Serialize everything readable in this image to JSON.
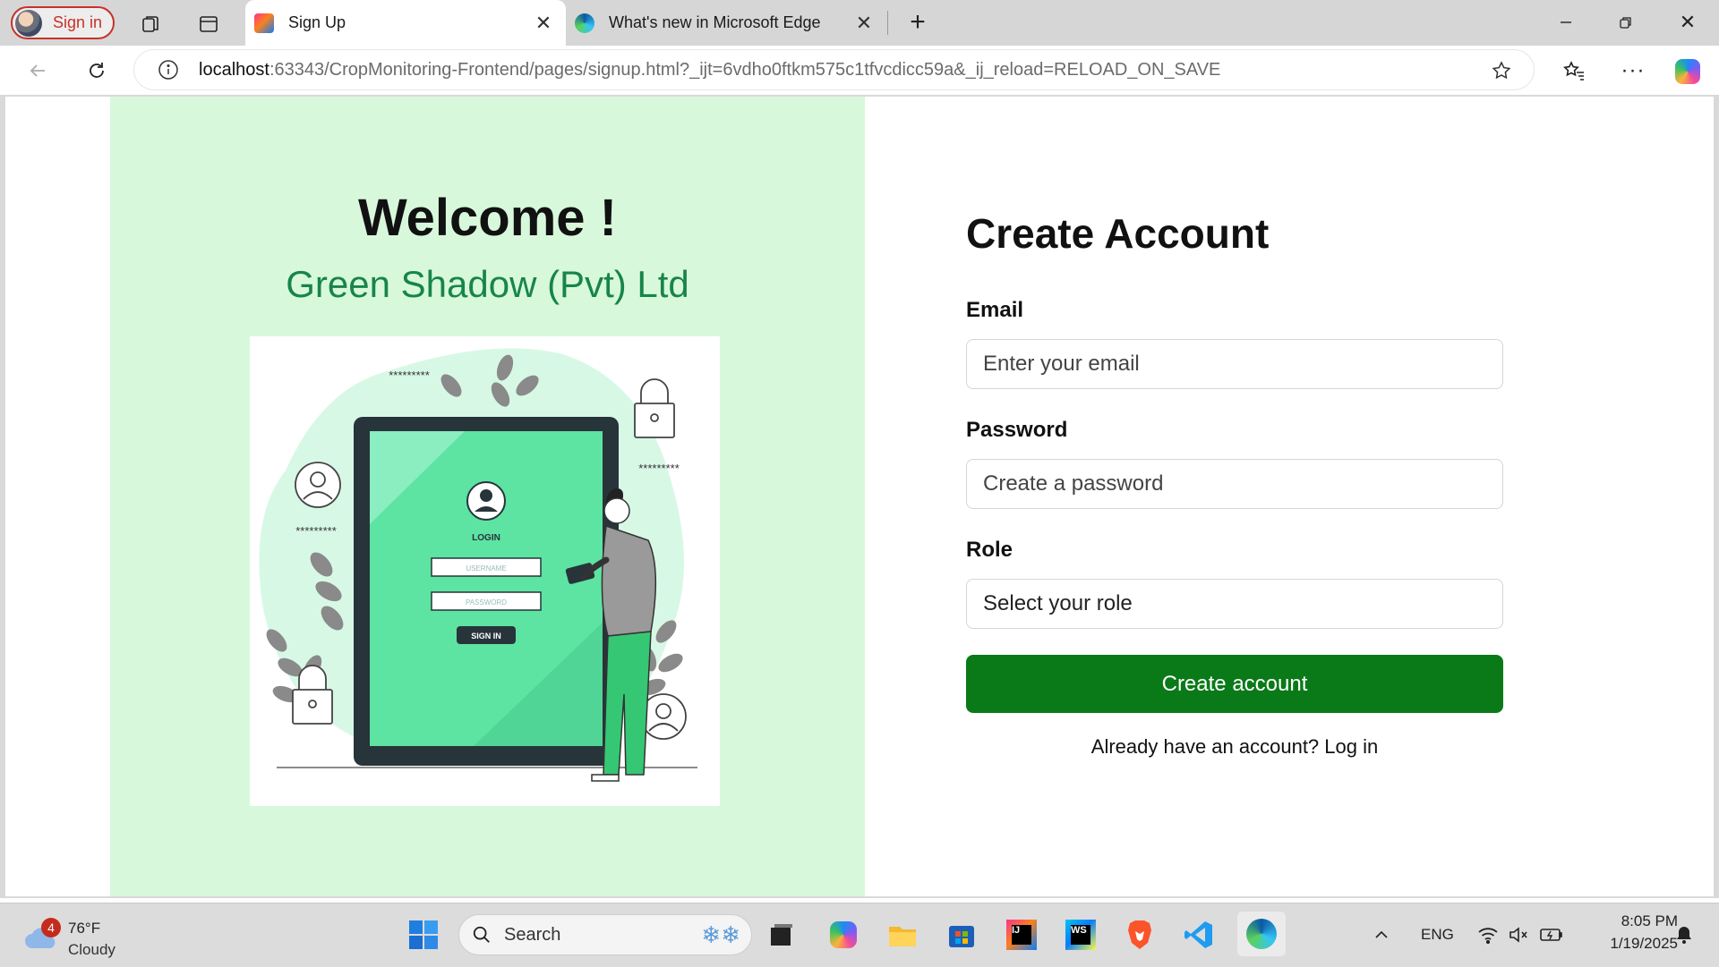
{
  "browser": {
    "profile_label": "Sign in",
    "tabs": [
      {
        "title": "Sign Up",
        "active": true
      },
      {
        "title": "What's new in Microsoft Edge",
        "active": false
      }
    ],
    "address": {
      "host": "localhost",
      "rest": ":63343/CropMonitoring-Frontend/pages/signup.html?_ijt=6vdho0ftkm575c1tfvcdicc59a&_ij_reload=RELOAD_ON_SAVE"
    }
  },
  "page": {
    "welcome": "Welcome !",
    "company": "Green Shadow (Pvt) Ltd",
    "illustration": {
      "login_title": "LOGIN",
      "username_placeholder": "USERNAME",
      "password_placeholder": "PASSWORD",
      "signin_label": "SIGN IN",
      "stars": "*********"
    },
    "form": {
      "title": "Create Account",
      "email_label": "Email",
      "email_placeholder": "Enter your email",
      "password_label": "Password",
      "password_placeholder": "Create a password",
      "role_label": "Role",
      "role_selected": "Select your role",
      "submit_label": "Create account",
      "login_prompt": "Already have an account? Log in"
    }
  },
  "taskbar": {
    "weather": {
      "badge": "4",
      "temp": "76°F",
      "condition": "Cloudy"
    },
    "search_label": "Search",
    "language": "ENG",
    "time": "8:05 PM",
    "date": "1/19/2025"
  },
  "colors": {
    "left_panel_bg": "#d8f8dc",
    "brand_green": "#17854a",
    "button_green": "#0a7a19",
    "illustration_green": "#5de3a2"
  }
}
